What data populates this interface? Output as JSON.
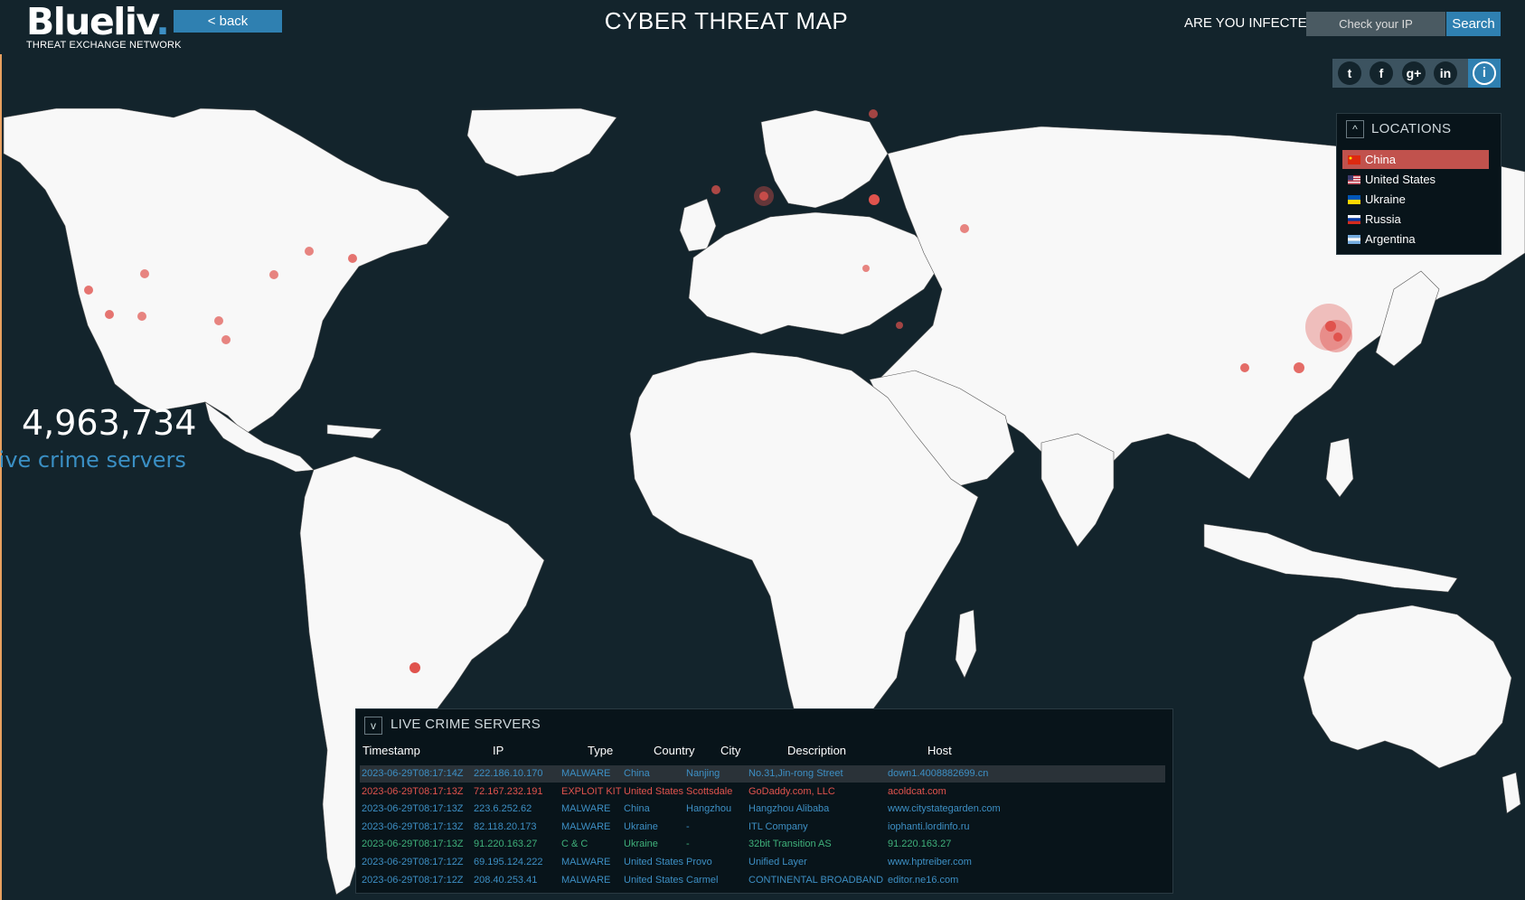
{
  "header": {
    "logo_main": "Blueliv",
    "logo_dot": ".",
    "logo_sub": "THREAT EXCHANGE NETWORK",
    "back_label": "< back",
    "title": "CYBER THREAT MAP",
    "infected_label": "ARE YOU INFECTED?",
    "ip_placeholder": "Check your IP",
    "search_label": "Search"
  },
  "social": {
    "icons": [
      "twitter-icon",
      "facebook-icon",
      "google-plus-icon",
      "linkedin-icon",
      "info-icon"
    ],
    "glyphs": {
      "twitter": "t",
      "facebook": "f",
      "google": "g+",
      "linkedin": "in",
      "info": "i"
    }
  },
  "locations": {
    "title": "LOCATIONS",
    "toggle": "^",
    "items": [
      {
        "name": "China",
        "selected": true
      },
      {
        "name": "United States",
        "selected": false
      },
      {
        "name": "Ukraine",
        "selected": false
      },
      {
        "name": "Russia",
        "selected": false
      },
      {
        "name": "Argentina",
        "selected": false
      }
    ]
  },
  "stats": {
    "count": "4,963,734",
    "label": "live crime servers"
  },
  "crime_servers": {
    "title": "LIVE CRIME SERVERS",
    "toggle": "v",
    "columns": [
      "Timestamp",
      "IP",
      "Type",
      "Country",
      "City",
      "Description",
      "Host"
    ],
    "rows": [
      {
        "timestamp": "2023-06-29T08:17:14Z",
        "ip": "222.186.10.170",
        "type": "MALWARE",
        "country": "China",
        "city": "Nanjing",
        "description": "No.31,Jin-rong Street",
        "host": "down1.4008882699.cn"
      },
      {
        "timestamp": "2023-06-29T08:17:13Z",
        "ip": "72.167.232.191",
        "type": "EXPLOIT KIT",
        "country": "United States",
        "city": "Scottsdale",
        "description": "GoDaddy.com, LLC",
        "host": "acoldcat.com"
      },
      {
        "timestamp": "2023-06-29T08:17:13Z",
        "ip": "223.6.252.62",
        "type": "MALWARE",
        "country": "China",
        "city": "Hangzhou",
        "description": "Hangzhou Alibaba",
        "host": "www.citystategarden.com"
      },
      {
        "timestamp": "2023-06-29T08:17:13Z",
        "ip": "82.118.20.173",
        "type": "MALWARE",
        "country": "Ukraine",
        "city": "-",
        "description": "ITL Company",
        "host": "iophanti.lordinfo.ru"
      },
      {
        "timestamp": "2023-06-29T08:17:13Z",
        "ip": "91.220.163.27",
        "type": "C & C",
        "country": "Ukraine",
        "city": "-",
        "description": "32bit Transition AS",
        "host": "91.220.163.27"
      },
      {
        "timestamp": "2023-06-29T08:17:12Z",
        "ip": "69.195.124.222",
        "type": "MALWARE",
        "country": "United States",
        "city": "Provo",
        "description": "Unified Layer",
        "host": "www.hptreiber.com"
      },
      {
        "timestamp": "2023-06-29T08:17:12Z",
        "ip": "208.40.253.41",
        "type": "MALWARE",
        "country": "United States",
        "city": "Carmel",
        "description": "CONTINENTAL BROADBAND",
        "host": "editor.ne16.com"
      }
    ],
    "type_colors": {
      "MALWARE": "#3d8fc4",
      "EXPLOIT KIT": "#e0534d",
      "C & C": "#3fb07a"
    }
  },
  "colors": {
    "background": "#13242c",
    "land": "#f8f8f8",
    "accent": "#2f80b1",
    "marker": "#e0534d",
    "selected": "#c1524d"
  }
}
